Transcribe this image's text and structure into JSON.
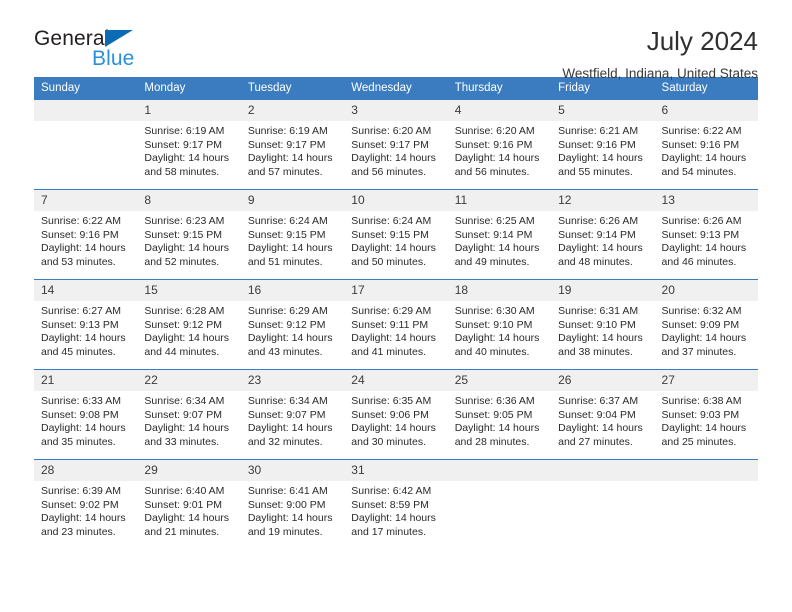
{
  "brand": {
    "name_part1": "General",
    "name_part2": "Blue",
    "accent_color": "#0b6cb5",
    "accent_color_light": "#2b90d9"
  },
  "header": {
    "title": "July 2024",
    "location": "Westfield, Indiana, United States"
  },
  "calendar": {
    "header_color": "#3a7cbf",
    "daynum_background": "#f0f0f0",
    "weekday_headers": [
      "Sunday",
      "Monday",
      "Tuesday",
      "Wednesday",
      "Thursday",
      "Friday",
      "Saturday"
    ],
    "weeks": [
      [
        {
          "day": "",
          "empty": true,
          "sunrise": "",
          "sunset": "",
          "daylight1": "",
          "daylight2": ""
        },
        {
          "day": "1",
          "sunrise": "Sunrise: 6:19 AM",
          "sunset": "Sunset: 9:17 PM",
          "daylight1": "Daylight: 14 hours",
          "daylight2": "and 58 minutes."
        },
        {
          "day": "2",
          "sunrise": "Sunrise: 6:19 AM",
          "sunset": "Sunset: 9:17 PM",
          "daylight1": "Daylight: 14 hours",
          "daylight2": "and 57 minutes."
        },
        {
          "day": "3",
          "sunrise": "Sunrise: 6:20 AM",
          "sunset": "Sunset: 9:17 PM",
          "daylight1": "Daylight: 14 hours",
          "daylight2": "and 56 minutes."
        },
        {
          "day": "4",
          "sunrise": "Sunrise: 6:20 AM",
          "sunset": "Sunset: 9:16 PM",
          "daylight1": "Daylight: 14 hours",
          "daylight2": "and 56 minutes."
        },
        {
          "day": "5",
          "sunrise": "Sunrise: 6:21 AM",
          "sunset": "Sunset: 9:16 PM",
          "daylight1": "Daylight: 14 hours",
          "daylight2": "and 55 minutes."
        },
        {
          "day": "6",
          "sunrise": "Sunrise: 6:22 AM",
          "sunset": "Sunset: 9:16 PM",
          "daylight1": "Daylight: 14 hours",
          "daylight2": "and 54 minutes."
        }
      ],
      [
        {
          "day": "7",
          "sunrise": "Sunrise: 6:22 AM",
          "sunset": "Sunset: 9:16 PM",
          "daylight1": "Daylight: 14 hours",
          "daylight2": "and 53 minutes."
        },
        {
          "day": "8",
          "sunrise": "Sunrise: 6:23 AM",
          "sunset": "Sunset: 9:15 PM",
          "daylight1": "Daylight: 14 hours",
          "daylight2": "and 52 minutes."
        },
        {
          "day": "9",
          "sunrise": "Sunrise: 6:24 AM",
          "sunset": "Sunset: 9:15 PM",
          "daylight1": "Daylight: 14 hours",
          "daylight2": "and 51 minutes."
        },
        {
          "day": "10",
          "sunrise": "Sunrise: 6:24 AM",
          "sunset": "Sunset: 9:15 PM",
          "daylight1": "Daylight: 14 hours",
          "daylight2": "and 50 minutes."
        },
        {
          "day": "11",
          "sunrise": "Sunrise: 6:25 AM",
          "sunset": "Sunset: 9:14 PM",
          "daylight1": "Daylight: 14 hours",
          "daylight2": "and 49 minutes."
        },
        {
          "day": "12",
          "sunrise": "Sunrise: 6:26 AM",
          "sunset": "Sunset: 9:14 PM",
          "daylight1": "Daylight: 14 hours",
          "daylight2": "and 48 minutes."
        },
        {
          "day": "13",
          "sunrise": "Sunrise: 6:26 AM",
          "sunset": "Sunset: 9:13 PM",
          "daylight1": "Daylight: 14 hours",
          "daylight2": "and 46 minutes."
        }
      ],
      [
        {
          "day": "14",
          "sunrise": "Sunrise: 6:27 AM",
          "sunset": "Sunset: 9:13 PM",
          "daylight1": "Daylight: 14 hours",
          "daylight2": "and 45 minutes."
        },
        {
          "day": "15",
          "sunrise": "Sunrise: 6:28 AM",
          "sunset": "Sunset: 9:12 PM",
          "daylight1": "Daylight: 14 hours",
          "daylight2": "and 44 minutes."
        },
        {
          "day": "16",
          "sunrise": "Sunrise: 6:29 AM",
          "sunset": "Sunset: 9:12 PM",
          "daylight1": "Daylight: 14 hours",
          "daylight2": "and 43 minutes."
        },
        {
          "day": "17",
          "sunrise": "Sunrise: 6:29 AM",
          "sunset": "Sunset: 9:11 PM",
          "daylight1": "Daylight: 14 hours",
          "daylight2": "and 41 minutes."
        },
        {
          "day": "18",
          "sunrise": "Sunrise: 6:30 AM",
          "sunset": "Sunset: 9:10 PM",
          "daylight1": "Daylight: 14 hours",
          "daylight2": "and 40 minutes."
        },
        {
          "day": "19",
          "sunrise": "Sunrise: 6:31 AM",
          "sunset": "Sunset: 9:10 PM",
          "daylight1": "Daylight: 14 hours",
          "daylight2": "and 38 minutes."
        },
        {
          "day": "20",
          "sunrise": "Sunrise: 6:32 AM",
          "sunset": "Sunset: 9:09 PM",
          "daylight1": "Daylight: 14 hours",
          "daylight2": "and 37 minutes."
        }
      ],
      [
        {
          "day": "21",
          "sunrise": "Sunrise: 6:33 AM",
          "sunset": "Sunset: 9:08 PM",
          "daylight1": "Daylight: 14 hours",
          "daylight2": "and 35 minutes."
        },
        {
          "day": "22",
          "sunrise": "Sunrise: 6:34 AM",
          "sunset": "Sunset: 9:07 PM",
          "daylight1": "Daylight: 14 hours",
          "daylight2": "and 33 minutes."
        },
        {
          "day": "23",
          "sunrise": "Sunrise: 6:34 AM",
          "sunset": "Sunset: 9:07 PM",
          "daylight1": "Daylight: 14 hours",
          "daylight2": "and 32 minutes."
        },
        {
          "day": "24",
          "sunrise": "Sunrise: 6:35 AM",
          "sunset": "Sunset: 9:06 PM",
          "daylight1": "Daylight: 14 hours",
          "daylight2": "and 30 minutes."
        },
        {
          "day": "25",
          "sunrise": "Sunrise: 6:36 AM",
          "sunset": "Sunset: 9:05 PM",
          "daylight1": "Daylight: 14 hours",
          "daylight2": "and 28 minutes."
        },
        {
          "day": "26",
          "sunrise": "Sunrise: 6:37 AM",
          "sunset": "Sunset: 9:04 PM",
          "daylight1": "Daylight: 14 hours",
          "daylight2": "and 27 minutes."
        },
        {
          "day": "27",
          "sunrise": "Sunrise: 6:38 AM",
          "sunset": "Sunset: 9:03 PM",
          "daylight1": "Daylight: 14 hours",
          "daylight2": "and 25 minutes."
        }
      ],
      [
        {
          "day": "28",
          "sunrise": "Sunrise: 6:39 AM",
          "sunset": "Sunset: 9:02 PM",
          "daylight1": "Daylight: 14 hours",
          "daylight2": "and 23 minutes."
        },
        {
          "day": "29",
          "sunrise": "Sunrise: 6:40 AM",
          "sunset": "Sunset: 9:01 PM",
          "daylight1": "Daylight: 14 hours",
          "daylight2": "and 21 minutes."
        },
        {
          "day": "30",
          "sunrise": "Sunrise: 6:41 AM",
          "sunset": "Sunset: 9:00 PM",
          "daylight1": "Daylight: 14 hours",
          "daylight2": "and 19 minutes."
        },
        {
          "day": "31",
          "sunrise": "Sunrise: 6:42 AM",
          "sunset": "Sunset: 8:59 PM",
          "daylight1": "Daylight: 14 hours",
          "daylight2": "and 17 minutes."
        },
        {
          "day": "",
          "empty": true,
          "sunrise": "",
          "sunset": "",
          "daylight1": "",
          "daylight2": ""
        },
        {
          "day": "",
          "empty": true,
          "sunrise": "",
          "sunset": "",
          "daylight1": "",
          "daylight2": ""
        },
        {
          "day": "",
          "empty": true,
          "sunrise": "",
          "sunset": "",
          "daylight1": "",
          "daylight2": ""
        }
      ]
    ]
  }
}
